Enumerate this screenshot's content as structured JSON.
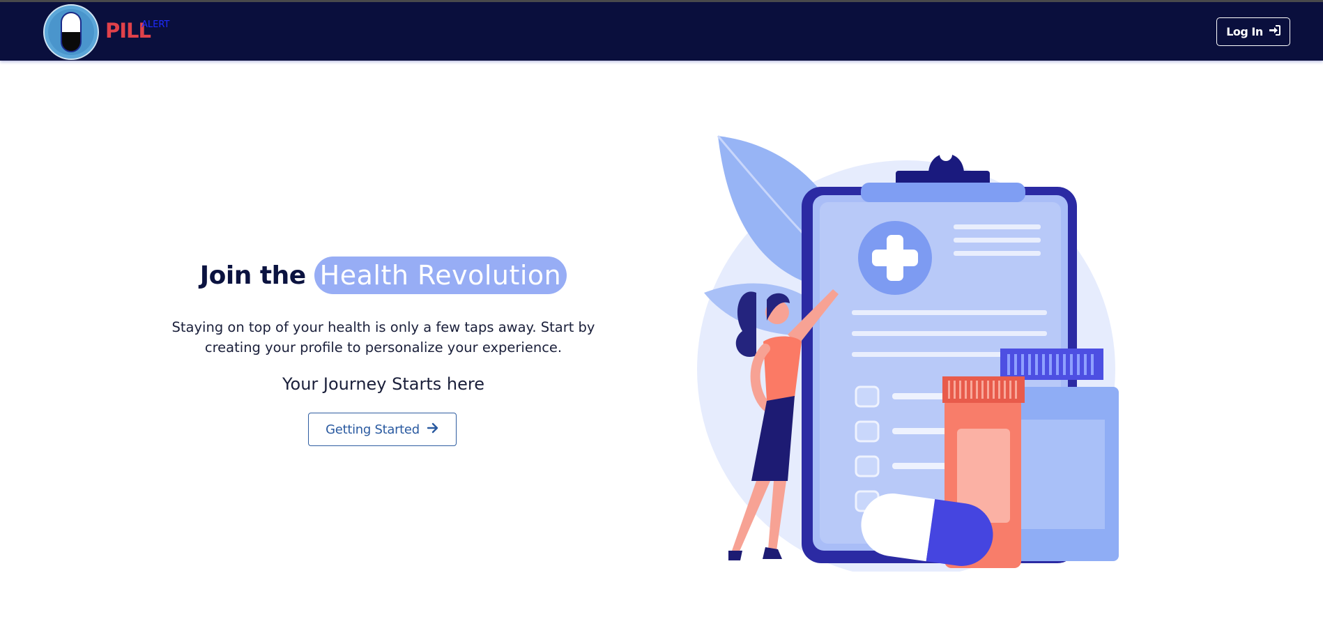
{
  "navbar": {
    "brand": "PILL",
    "brand_sup": "ALERT",
    "login_label": "Log In",
    "login_icon": "sign-in-icon"
  },
  "hero": {
    "headline_plain": "Join the",
    "headline_highlight": "Health Revolution",
    "description_line1": "Staying on top of your health is only a few taps away. Start by",
    "description_line2": "creating your profile to personalize your experience.",
    "journey": "Your Journey Starts here",
    "cta_label": "Getting Started",
    "cta_icon": "arrow-right-icon"
  },
  "colors": {
    "navbar_bg": "#0a0f3d",
    "brand_red": "#e0414a",
    "highlight": "#97adf5",
    "cta_border": "#2e5da0"
  }
}
